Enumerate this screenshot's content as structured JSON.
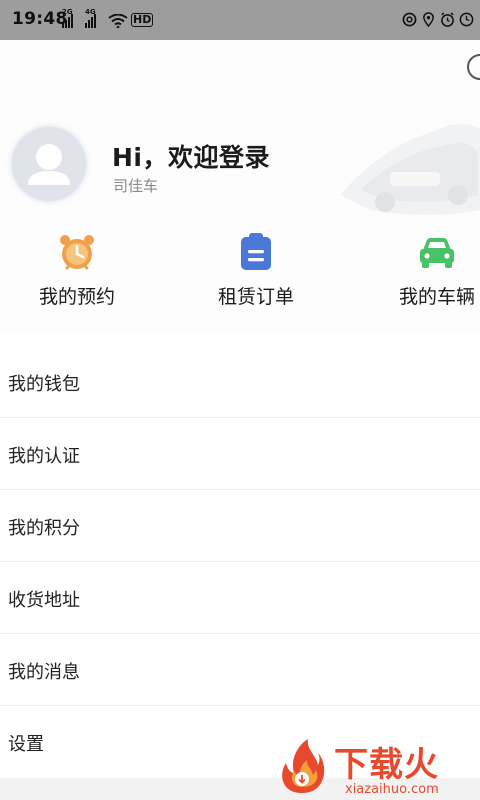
{
  "status_bar": {
    "time": "19:48",
    "sig1_tag": "2G",
    "sig2_tag": "4G",
    "hd": "HD",
    "icons": [
      "wifi-icon",
      "at-icon",
      "location-icon",
      "alarm-icon",
      "clock-icon"
    ]
  },
  "profile": {
    "greeting": "Hi，欢迎登录",
    "subtitle": "司佳车"
  },
  "quick_actions": [
    {
      "label": "我的预约",
      "icon": "alarm-clock-icon",
      "color": "#f0a04b"
    },
    {
      "label": "租赁订单",
      "icon": "clipboard-icon",
      "color": "#4a78d6"
    },
    {
      "label": "我的车辆",
      "icon": "car-icon",
      "color": "#47c266"
    }
  ],
  "menu": [
    {
      "label": "我的钱包"
    },
    {
      "label": "我的认证"
    },
    {
      "label": "我的积分"
    },
    {
      "label": "收货地址"
    },
    {
      "label": "我的消息"
    },
    {
      "label": "设置"
    }
  ],
  "watermark": {
    "brand": "下载火",
    "url": "xiazaihuo.com",
    "color": "#e8492d"
  }
}
